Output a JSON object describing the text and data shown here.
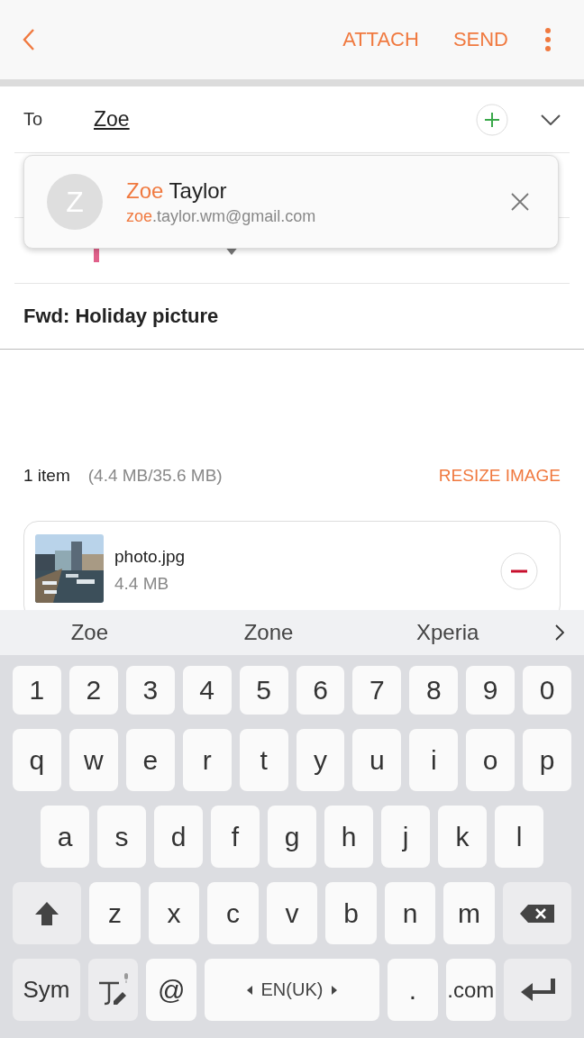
{
  "toolbar": {
    "actions": [
      "ATTACH",
      "SEND"
    ]
  },
  "to": {
    "label": "To",
    "value": "Zoe"
  },
  "suggestion": {
    "avatar": "Z",
    "name_match": "Zoe",
    "name_rest": " Taylor",
    "email_match": "zoe",
    "email_rest": ".taylor.wm@gmail.com"
  },
  "from": {
    "color": "#e0608a"
  },
  "subject": "Fwd: Holiday picture",
  "attachments": {
    "count": "1 item",
    "size": "(4.4 MB/35.6 MB)",
    "action": "RESIZE IMAGE",
    "files": [
      {
        "name": "photo.jpg",
        "size": "4.4 MB"
      }
    ]
  },
  "keyboard": {
    "suggestions": [
      "Zoe",
      "Zone",
      "Xperia"
    ],
    "rows": [
      {
        "keys": [
          {
            "kind": "num",
            "label": "1"
          },
          {
            "kind": "num",
            "label": "2"
          },
          {
            "kind": "num",
            "label": "3"
          },
          {
            "kind": "num",
            "label": "4"
          },
          {
            "kind": "num",
            "label": "5"
          },
          {
            "kind": "num",
            "label": "6"
          },
          {
            "kind": "num",
            "label": "7"
          },
          {
            "kind": "num",
            "label": "8"
          },
          {
            "kind": "num",
            "label": "9"
          },
          {
            "kind": "num",
            "label": "0"
          }
        ]
      },
      {
        "keys": [
          {
            "kind": "char",
            "label": "q"
          },
          {
            "kind": "char",
            "label": "w"
          },
          {
            "kind": "char",
            "label": "e"
          },
          {
            "kind": "char",
            "label": "r"
          },
          {
            "kind": "char",
            "label": "t"
          },
          {
            "kind": "char",
            "label": "y"
          },
          {
            "kind": "char",
            "label": "u"
          },
          {
            "kind": "char",
            "label": "i"
          },
          {
            "kind": "char",
            "label": "o"
          },
          {
            "kind": "char",
            "label": "p"
          }
        ]
      },
      {
        "keys": [
          {
            "kind": "char",
            "label": "a"
          },
          {
            "kind": "char",
            "label": "s"
          },
          {
            "kind": "char",
            "label": "d"
          },
          {
            "kind": "char",
            "label": "f"
          },
          {
            "kind": "char",
            "label": "g"
          },
          {
            "kind": "char",
            "label": "h"
          },
          {
            "kind": "char",
            "label": "j"
          },
          {
            "kind": "char",
            "label": "k"
          },
          {
            "kind": "char",
            "label": "l"
          }
        ]
      },
      {
        "keys": [
          {
            "kind": "shift"
          },
          {
            "kind": "char",
            "label": "z"
          },
          {
            "kind": "char",
            "label": "x"
          },
          {
            "kind": "char",
            "label": "c"
          },
          {
            "kind": "char",
            "label": "v"
          },
          {
            "kind": "char",
            "label": "b"
          },
          {
            "kind": "char",
            "label": "n"
          },
          {
            "kind": "char",
            "label": "m"
          },
          {
            "kind": "backspace"
          }
        ]
      },
      {
        "keys": [
          {
            "kind": "sym",
            "label": "Sym"
          },
          {
            "kind": "handwriting"
          },
          {
            "kind": "char",
            "label": "@"
          },
          {
            "kind": "space",
            "label": "EN(UK)"
          },
          {
            "kind": "char",
            "label": "."
          },
          {
            "kind": "char",
            "label": ".com"
          },
          {
            "kind": "enter"
          }
        ]
      }
    ]
  }
}
